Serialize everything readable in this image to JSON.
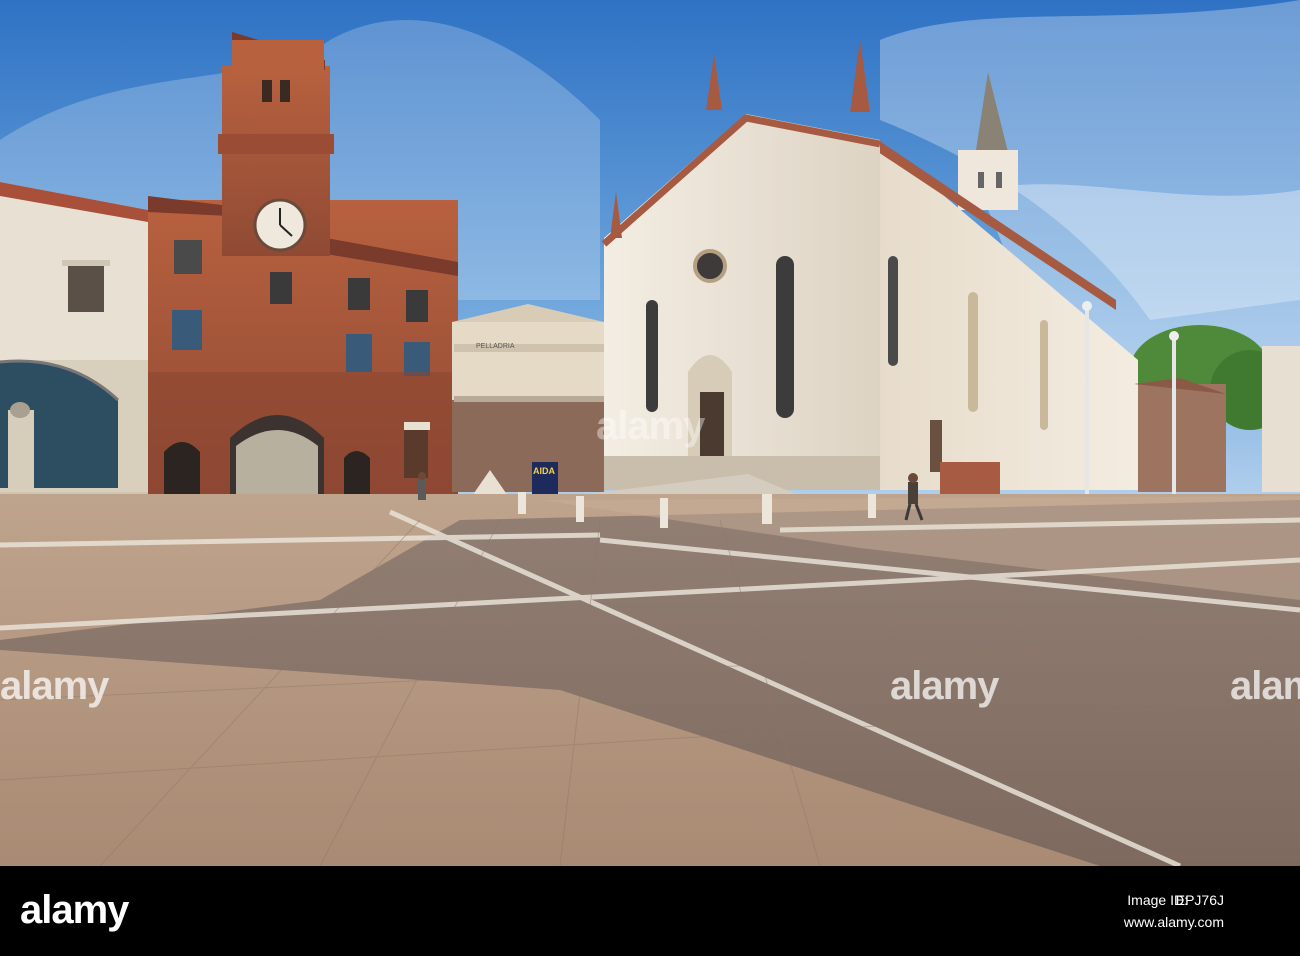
{
  "photo": {
    "description_colors": {
      "sky": "#3f86cf",
      "brick": "#a9583a",
      "church": "#eae3d6",
      "pavement": "#b59a84"
    },
    "signs": {
      "aida": "AIDA",
      "pelleadria": "PELLADRIA"
    }
  },
  "watermark": {
    "text": "alamy"
  },
  "footer": {
    "logo": "alamy",
    "image_id_label": "Image ID:",
    "image_id": "EPJ76J",
    "url": "www.alamy.com"
  }
}
